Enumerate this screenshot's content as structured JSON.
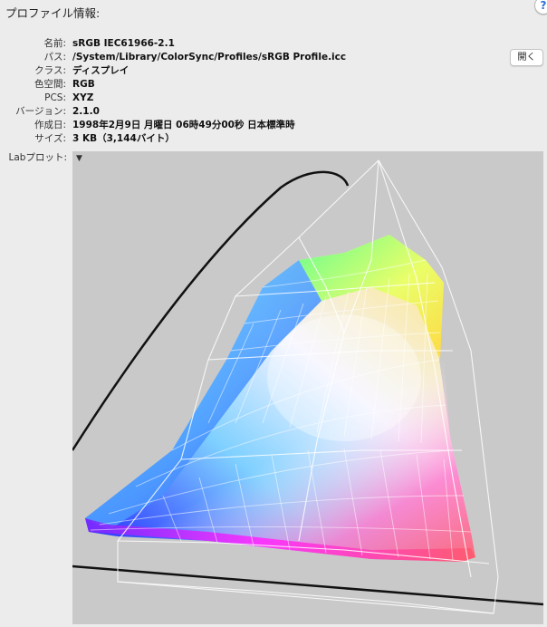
{
  "header": {
    "title": "プロファイル情報:",
    "help_glyph": "?"
  },
  "info": {
    "rows": [
      {
        "label": "名前:",
        "value": "sRGB IEC61966-2.1"
      },
      {
        "label": "パス:",
        "value": "/System/Library/ColorSync/Profiles/sRGB Profile.icc"
      },
      {
        "label": "クラス:",
        "value": "ディスプレイ"
      },
      {
        "label": "色空間:",
        "value": "RGB"
      },
      {
        "label": "PCS:",
        "value": "XYZ"
      },
      {
        "label": "バージョン:",
        "value": "2.1.0"
      },
      {
        "label": "作成日:",
        "value": "1998年2月9日 月曜日 06時49分00秒 日本標準時"
      },
      {
        "label": "サイズ:",
        "value": "3 KB（3,144バイト）"
      }
    ],
    "open_button": "開く"
  },
  "lab_plot": {
    "label": "Labプロット:",
    "menu_glyph": "▼",
    "background": "#c9c9c9"
  }
}
